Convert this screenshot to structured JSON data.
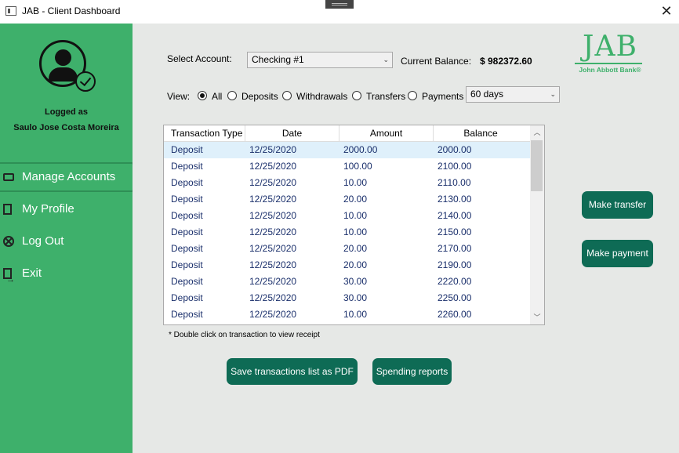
{
  "window": {
    "title": "JAB - Client Dashboard",
    "close_glyph": "✕"
  },
  "sidebar": {
    "logged_as_label": "Logged as",
    "user_name": "Saulo Jose Costa Moreira",
    "items": [
      {
        "label": "Manage Accounts",
        "icon": "wallet-icon",
        "active": true
      },
      {
        "label": "My Profile",
        "icon": "profile-document-icon",
        "active": false
      },
      {
        "label": "Log Out",
        "icon": "logout-circle-x-icon",
        "active": false
      },
      {
        "label": "Exit",
        "icon": "exit-door-icon",
        "active": false
      }
    ],
    "accent_color": "#3eb06b"
  },
  "account": {
    "select_label": "Select Account:",
    "selected": "Checking  #1",
    "balance_label": "Current Balance:",
    "balance_value": "$ 982372.60"
  },
  "view": {
    "label": "View:",
    "options": [
      "All",
      "Deposits",
      "Withdrawals",
      "Transfers",
      "Payments"
    ],
    "selected": "All",
    "period": "60 days"
  },
  "logo": {
    "text": "JAB",
    "subtitle": "John Abbott Bank®"
  },
  "table": {
    "columns": [
      "Transaction Type",
      "Date",
      "Amount",
      "Balance"
    ],
    "rows": [
      [
        "Deposit",
        "12/25/2020",
        "2000.00",
        "2000.00"
      ],
      [
        "Deposit",
        "12/25/2020",
        "100.00",
        "2100.00"
      ],
      [
        "Deposit",
        "12/25/2020",
        "10.00",
        "2110.00"
      ],
      [
        "Deposit",
        "12/25/2020",
        "20.00",
        "2130.00"
      ],
      [
        "Deposit",
        "12/25/2020",
        "10.00",
        "2140.00"
      ],
      [
        "Deposit",
        "12/25/2020",
        "10.00",
        "2150.00"
      ],
      [
        "Deposit",
        "12/25/2020",
        "20.00",
        "2170.00"
      ],
      [
        "Deposit",
        "12/25/2020",
        "20.00",
        "2190.00"
      ],
      [
        "Deposit",
        "12/25/2020",
        "30.00",
        "2220.00"
      ],
      [
        "Deposit",
        "12/25/2020",
        "30.00",
        "2250.00"
      ],
      [
        "Deposit",
        "12/25/2020",
        "10.00",
        "2260.00"
      ]
    ],
    "selected_row": 0,
    "note": "* Double click on transaction to view receipt"
  },
  "buttons": {
    "make_transfer": "Make transfer",
    "make_payment": "Make payment",
    "save_pdf": "Save transactions list as PDF",
    "spending_reports": "Spending reports",
    "button_color": "#0e6b55"
  }
}
